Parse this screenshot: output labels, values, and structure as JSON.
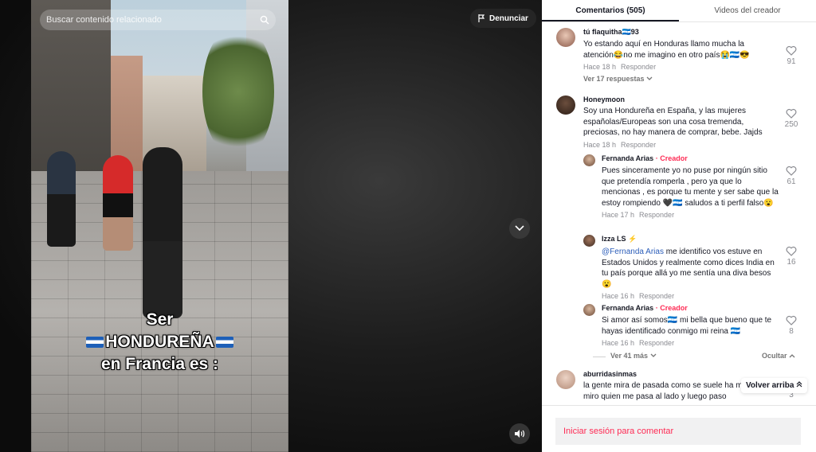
{
  "search": {
    "placeholder": "Buscar contenido relacionado"
  },
  "report_button": {
    "label": "Denunciar"
  },
  "video": {
    "caption_line1": "Ser",
    "caption_line2": "HONDUREÑA",
    "caption_line3": "en Francia es :"
  },
  "tabs": [
    {
      "label": "Comentarios (505)",
      "active": true
    },
    {
      "label": "Videos del creador",
      "active": false
    }
  ],
  "comments": [
    {
      "user": "tú flaquitha🇭🇳93",
      "text": "Yo estando aquí en Honduras llamo mucha la atención😂no me imagino en otro país😭🇭🇳😎",
      "time": "Hace 18 h",
      "reply": "Responder",
      "likes": "91",
      "view_replies": "Ver 17 respuestas"
    },
    {
      "user": "Honeymoon",
      "text": "Soy una Hondureña en España, y las mujeres españolas/Europeas son una cosa tremenda, preciosas, no hay manera de comprar, bebe. Jajds",
      "time": "Hace 18 h",
      "reply": "Responder",
      "likes": "250",
      "replies": [
        {
          "user": "Fernanda Arias",
          "tag": " · Creador",
          "text": "Pues sinceramente yo no puse por ningún sitio que pretendía romperla , pero ya que lo mencionas , es porque tu mente y ser sabe que la estoy rompiendo 🖤🇭🇳 saludos a ti perfil falso😮",
          "time": "Hace 17 h",
          "reply": "Responder",
          "likes": "61"
        },
        {
          "user": "Izza LS ⚡",
          "mention": "@Fernanda Arias",
          "text": " me identifico vos estuve en Estados Unidos y realmente como dices India en tu país porque allá yo me sentía una diva besos 😮",
          "time": "Hace 16 h",
          "reply": "Responder",
          "likes": "16"
        },
        {
          "user": "Fernanda Arias",
          "tag": " · Creador",
          "text": "Si amor así somos🇭🇳 mi bella que bueno que te hayas identificado conmigo mi reina 🇭🇳",
          "time": "Hace 16 h",
          "reply": "Responder",
          "likes": "8"
        }
      ],
      "view_more": "Ver 41 más",
      "hide": "Ocultar"
    },
    {
      "user": "aburridasinmas",
      "text": "la gente mira de pasada como se suele ha misma miro quien me pasa al lado y luego paso",
      "likes": "3"
    }
  ],
  "back_to_top": "Volver arriba",
  "login": {
    "label": "Iniciar sesión para comentar"
  },
  "colors": {
    "accent": "#fe2c55",
    "mention": "#2b5db9",
    "text": "#161823",
    "muted": "#8a8b91"
  }
}
